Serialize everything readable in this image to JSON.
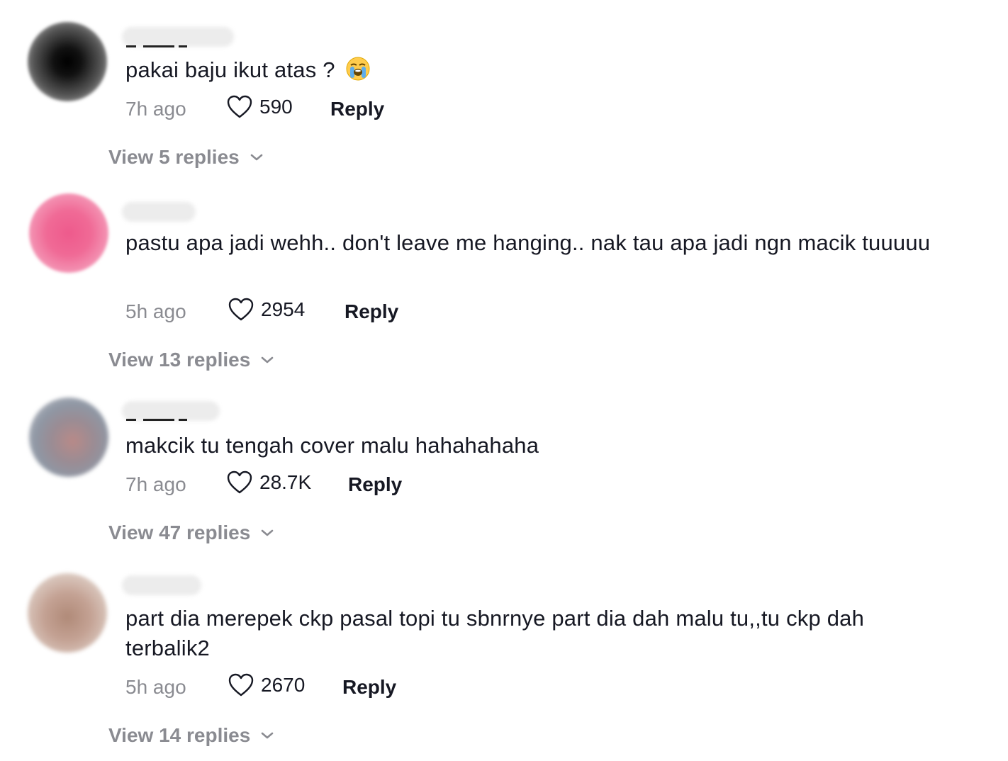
{
  "comments": [
    {
      "text": "pakai baju ikut atas ? ",
      "emoji": "loudly-crying-face-icon",
      "time": "7h ago",
      "likes": "590",
      "reply": "Reply",
      "view_replies": "View 5 replies",
      "avatar_color": "#1a1a1a"
    },
    {
      "text": "pastu apa jadi wehh.. don't leave me hanging.. nak tau apa jadi ngn macik tuuuuu",
      "time": "5h ago",
      "likes": "2954",
      "reply": "Reply",
      "view_replies": "View 13 replies",
      "avatar_color": "#ee5a8c"
    },
    {
      "text": "makcik tu tengah cover malu hahahahaha",
      "time": "7h ago",
      "likes": "28.7K",
      "reply": "Reply",
      "view_replies": "View 47 replies",
      "avatar_color": "#a59394"
    },
    {
      "text": "part dia merepek ckp pasal topi tu sbnrnye part dia dah malu tu,,tu ckp dah terbalik2",
      "time": "5h ago",
      "likes": "2670",
      "reply": "Reply",
      "view_replies": "View 14 replies",
      "avatar_color": "#c8a89a"
    }
  ],
  "colors": {
    "text": "#161823",
    "muted": "#8a8b91",
    "background": "#ffffff"
  }
}
